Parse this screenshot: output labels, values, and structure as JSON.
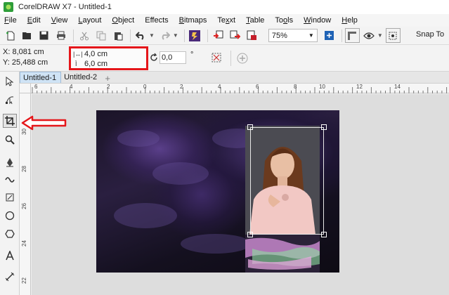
{
  "window": {
    "title": "CorelDRAW X7 - Untitled-1"
  },
  "menu": [
    {
      "label": "File",
      "key": "F",
      "rest": "ile"
    },
    {
      "label": "Edit",
      "key": "E",
      "rest": "dit"
    },
    {
      "label": "View",
      "key": "V",
      "rest": "iew"
    },
    {
      "label": "Layout",
      "key": "L",
      "rest": "ayout"
    },
    {
      "label": "Object",
      "key": "O",
      "rest": "bject"
    },
    {
      "label": "Effects",
      "key": "E",
      "rest": "ffects"
    },
    {
      "label": "Bitmaps",
      "key": "B",
      "rest": "itmaps"
    },
    {
      "label": "Text",
      "key": "T",
      "rest": "e",
      "rest2": "xt",
      "key2": "x"
    },
    {
      "label": "Table",
      "key": "T",
      "rest": "able"
    },
    {
      "label": "Tools",
      "key": "T",
      "rest": "o",
      "key2": "o",
      "rest2": "ls"
    },
    {
      "label": "Window",
      "key": "W",
      "rest": "indow"
    },
    {
      "label": "Help",
      "key": "H",
      "rest": "elp"
    }
  ],
  "toolbar": {
    "zoom_value": "75%",
    "snap_label": "Snap To"
  },
  "propbar": {
    "x_label": "X:",
    "x_value": "8,081 cm",
    "y_label": "Y:",
    "y_value": "25,488 cm",
    "width_value": "4,0 cm",
    "height_value": "6,0 cm",
    "rotation_value": "0,0",
    "degree_symbol": "°"
  },
  "tabs": [
    {
      "label": "Untitled-1",
      "active": true
    },
    {
      "label": "Untitled-2",
      "active": false
    }
  ],
  "ruler": {
    "h_labels": [
      "6",
      "4",
      "2",
      "0",
      "2",
      "4",
      "6",
      "8",
      "10",
      "12",
      "14"
    ],
    "v_labels": [
      "30",
      "28",
      "26",
      "24",
      "22",
      "20"
    ]
  },
  "colors": {
    "highlight_red": "#e5161a",
    "tab_active": "#cfe3f5",
    "canvas_bg": "#dddddd"
  },
  "tools": [
    "pick-tool",
    "shape-tool",
    "crop-tool",
    "zoom-tool",
    "pen-tool",
    "smart-drawing-tool",
    "artistic-media-tool",
    "rectangle-tool",
    "ellipse-tool",
    "polygon-tool",
    "text-tool",
    "parallel-dimension-tool"
  ]
}
